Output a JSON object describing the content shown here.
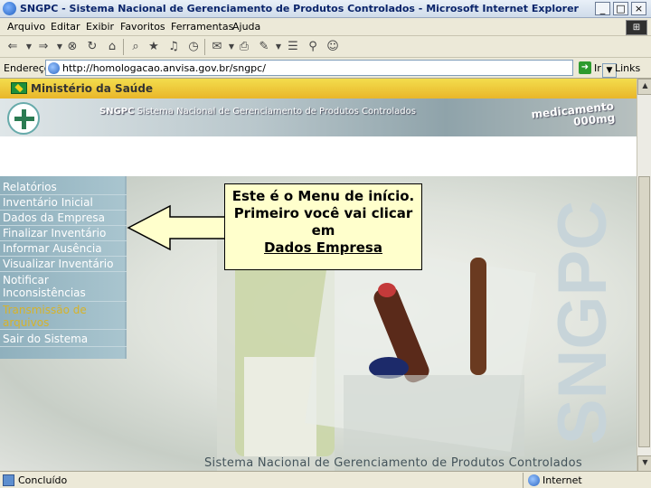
{
  "window": {
    "title": "SNGPC - Sistema Nacional de Gerenciamento de Produtos Controlados - Microsoft Internet Explorer"
  },
  "menubar": {
    "items": [
      "Arquivo",
      "Editar",
      "Exibir",
      "Favoritos",
      "Ferramentas",
      "Ajuda"
    ]
  },
  "address": {
    "label": "Endereço",
    "url": "http://homologacao.anvisa.gov.br/sngpc/",
    "go_label": "Ir",
    "links_label": "Links"
  },
  "page": {
    "ministry": "Ministério da Saúde",
    "banner_bold": "SNGPC",
    "banner_title": "Sistema Nacional de Gerenciamento de Produtos Controlados",
    "banner_med_line1": "medicamento",
    "banner_med_line2": "000mg",
    "side_logo": "SNGPC",
    "footer": "Sistema Nacional de Gerenciamento de Produtos Controlados"
  },
  "nav": {
    "items": [
      {
        "label": "Relatórios"
      },
      {
        "label": "Inventário Inicial"
      },
      {
        "label": "Dados da Empresa"
      },
      {
        "label": "Finalizar Inventário"
      },
      {
        "label": "Informar Ausência"
      },
      {
        "label": "Visualizar Inventário"
      },
      {
        "label": "Notificar Inconsistências"
      },
      {
        "label": "Transmissão de arquivos"
      },
      {
        "label": "Sair do Sistema"
      }
    ]
  },
  "callout": {
    "line1": "Este é o Menu de início.",
    "line2": "Primeiro você vai clicar",
    "line3": "em",
    "line4": "Dados Empresa"
  },
  "statusbar": {
    "status": "Concluído",
    "zone": "Internet"
  },
  "colors": {
    "callout_bg": "#ffffcc",
    "nav_bg": "#9ab9c5",
    "nav_active": "#d6b32a",
    "ministry_bar": "#efc63a"
  }
}
